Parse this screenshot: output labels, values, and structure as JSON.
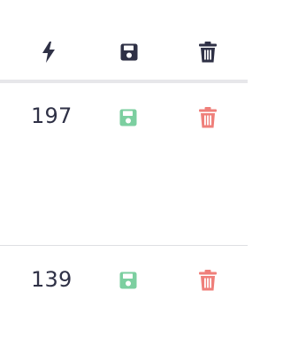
{
  "colors": {
    "header_icon": "#2f3146",
    "save_icon": "#7ccfa0",
    "delete_icon": "#ef7f7a",
    "divider_header": "#e7e7ea",
    "divider_row": "#dedfe3"
  },
  "header": {
    "icons": [
      "bolt-icon",
      "save-icon",
      "trash-icon"
    ]
  },
  "rows": [
    {
      "value": "197",
      "actions": [
        "save-icon",
        "trash-icon"
      ]
    },
    {
      "value": "139",
      "actions": [
        "save-icon",
        "trash-icon"
      ]
    }
  ]
}
